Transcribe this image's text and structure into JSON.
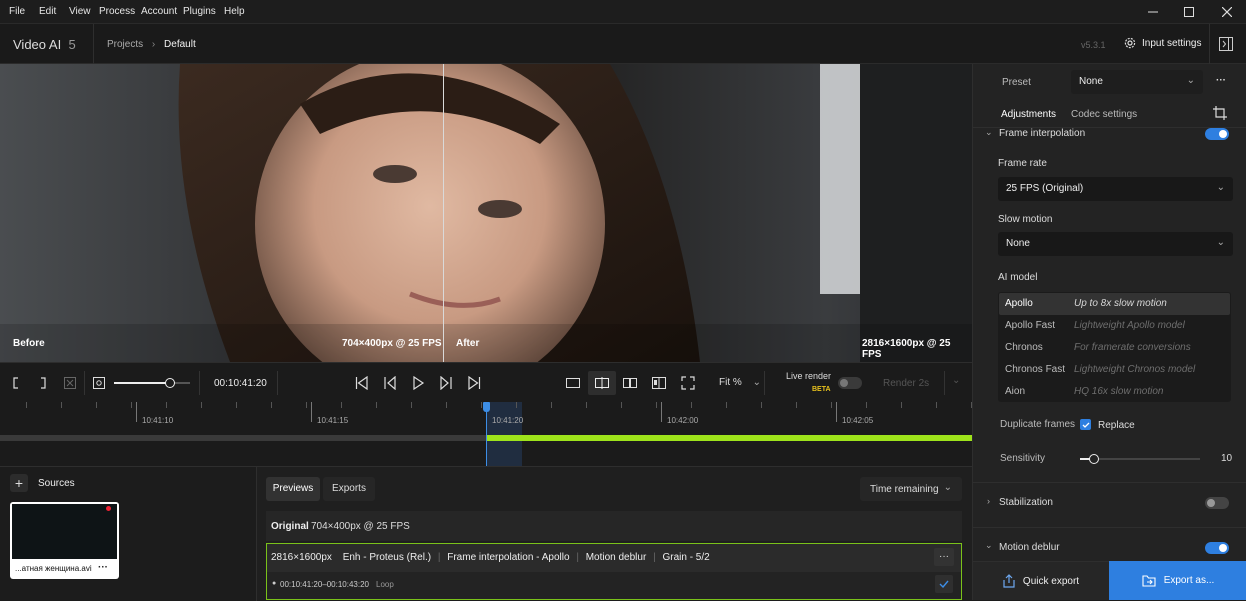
{
  "menu": [
    "File",
    "Edit",
    "View",
    "Process",
    "Account",
    "Plugins",
    "Help"
  ],
  "app": {
    "name": "Video AI",
    "major": "5",
    "breadcrumb_root": "Projects",
    "breadcrumb_current": "Default",
    "version": "v5.3.1",
    "input_settings": "Input settings"
  },
  "viewer": {
    "before_label": "Before",
    "before_res": "704×400px @ 25 FPS",
    "after_label": "After",
    "after_res": "2816×1600px @ 25 FPS"
  },
  "transport": {
    "timecode": "00:10:41:20",
    "fit": "Fit %",
    "live_render": "Live render",
    "beta": "BETA",
    "render_btn": "Render 2s"
  },
  "timeline": {
    "labels": [
      "10:41:10",
      "10:41:15",
      "10:41:20",
      "10:42:00",
      "10:42:05"
    ]
  },
  "sources": {
    "title": "Sources",
    "file": "...атная женщина.avi",
    "more": "···"
  },
  "previews": {
    "tab_previews": "Previews",
    "tab_exports": "Exports",
    "sort": "Time remaining",
    "original_label": "Original",
    "original_res": "704×400px @ 25 FPS",
    "job": {
      "res": "2816×1600px",
      "enh": "Enh - Proteus (Rel.)",
      "fi": "Frame interpolation - Apollo",
      "deblur": "Motion deblur",
      "grain": "Grain - 5/2",
      "range": "00:10:41:20–00:10:43:20",
      "loop": "Loop",
      "more": "···"
    }
  },
  "panel": {
    "preset_label": "Preset",
    "preset_value": "None",
    "preset_more": "···",
    "tab_adjustments": "Adjustments",
    "tab_codec": "Codec settings",
    "frame_interp": "Frame interpolation",
    "frame_rate_label": "Frame rate",
    "frame_rate_value": "25 FPS (Original)",
    "slow_motion_label": "Slow motion",
    "slow_motion_value": "None",
    "ai_model_label": "AI model",
    "models": [
      {
        "name": "Apollo",
        "desc": "Up to 8x slow motion"
      },
      {
        "name": "Apollo Fast",
        "desc": "Lightweight Apollo model"
      },
      {
        "name": "Chronos",
        "desc": "For framerate conversions"
      },
      {
        "name": "Chronos Fast",
        "desc": "Lightweight Chronos model"
      },
      {
        "name": "Aion",
        "desc": "HQ 16x slow motion"
      }
    ],
    "dup_frames_label": "Duplicate frames",
    "replace_label": "Replace",
    "sensitivity_label": "Sensitivity",
    "sensitivity_value": "10",
    "sensitivity_level": 0.12,
    "stabilization": "Stabilization",
    "motion_deblur": "Motion deblur",
    "quick_export": "Quick export",
    "export_as": "Export as..."
  },
  "colors": {
    "accent": "#3d8ee6",
    "green": "#9ee31b",
    "export_btn": "#2e7fe0"
  }
}
